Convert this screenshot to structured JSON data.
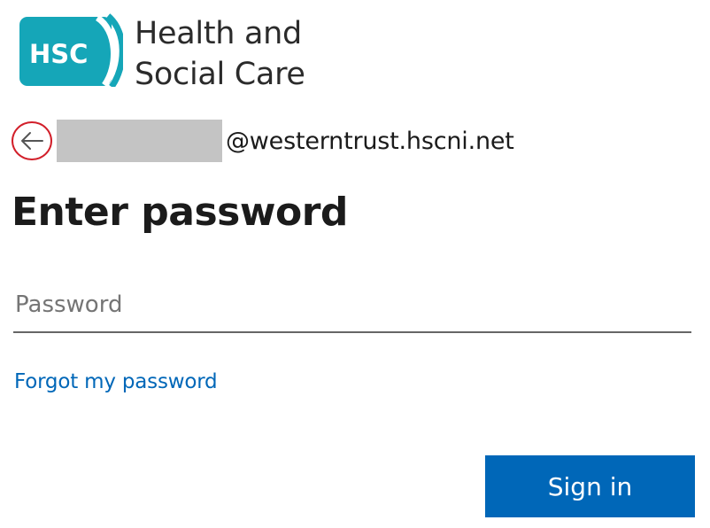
{
  "brand": {
    "badge_text": "HSC",
    "name_line1": "Health and",
    "name_line2": "Social Care",
    "color": "#15a6b8"
  },
  "identity": {
    "back_icon": "arrow-left-icon",
    "email_suffix": "@westerntrust.hscni.net"
  },
  "form": {
    "title": "Enter password",
    "password_placeholder": "Password",
    "password_value": "",
    "forgot_link": "Forgot my password",
    "submit_label": "Sign in"
  },
  "colors": {
    "accent": "#0067b8",
    "highlight_ring": "#d21f2a",
    "redaction": "#c4c4c4"
  }
}
